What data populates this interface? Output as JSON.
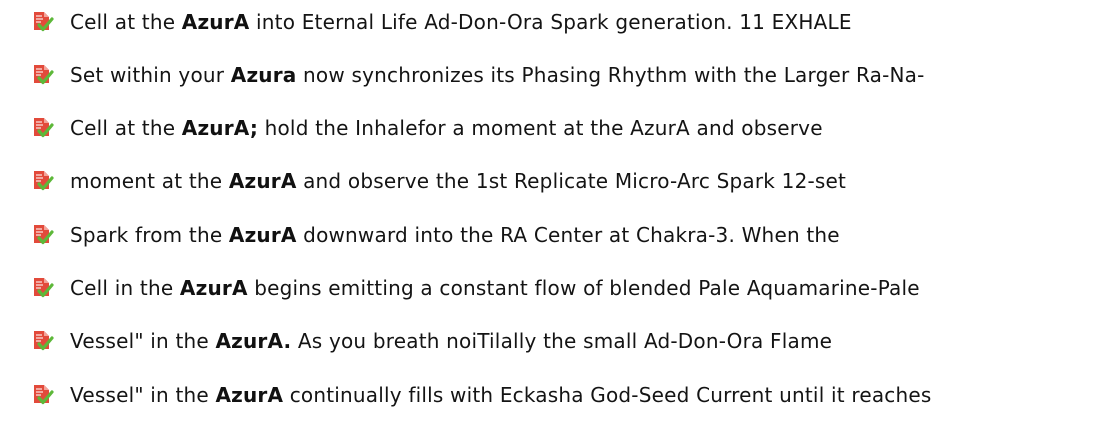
{
  "results": [
    {
      "icon": "document-check-icon",
      "prefix": "Cell at the",
      "keyword": "AzurA",
      "suffix": "into Eternal Life Ad-Don-Ora Spark generation. 11 EXHALE"
    },
    {
      "icon": "document-check-icon",
      "prefix": "Set within your",
      "keyword": "Azura",
      "suffix": "now synchronizes its Phasing Rhythm with the Larger Ra-Na-"
    },
    {
      "icon": "document-check-icon",
      "prefix": "Cell at the",
      "keyword": "AzurA;",
      "suffix": "hold the Inhalefor a moment at the AzurA and observe"
    },
    {
      "icon": "document-check-icon",
      "prefix": "moment at the",
      "keyword": "AzurA",
      "suffix": "and observe the 1st Replicate Micro-Arc Spark 12-set"
    },
    {
      "icon": "document-check-icon",
      "prefix": "Spark from the",
      "keyword": "AzurA",
      "suffix": "downward into the RA Center at Chakra-3. When the"
    },
    {
      "icon": "document-check-icon",
      "prefix": "Cell in the",
      "keyword": "AzurA",
      "suffix": "begins emitting a constant flow of blended Pale Aquamarine-Pale"
    },
    {
      "icon": "document-check-icon",
      "prefix": "Vessel\" in the",
      "keyword": "AzurA.",
      "suffix": "As you breath noiTilally the small Ad-Don-Ora Flame"
    },
    {
      "icon": "document-check-icon",
      "prefix": "Vessel\" in the",
      "keyword": "AzurA",
      "suffix": "continually fills with Eckasha God-Seed Current until it reaches"
    }
  ],
  "colors": {
    "icon_page": "#e24a3b",
    "icon_fold": "#f2a39a",
    "icon_check": "#5db83a",
    "text": "#141414"
  }
}
